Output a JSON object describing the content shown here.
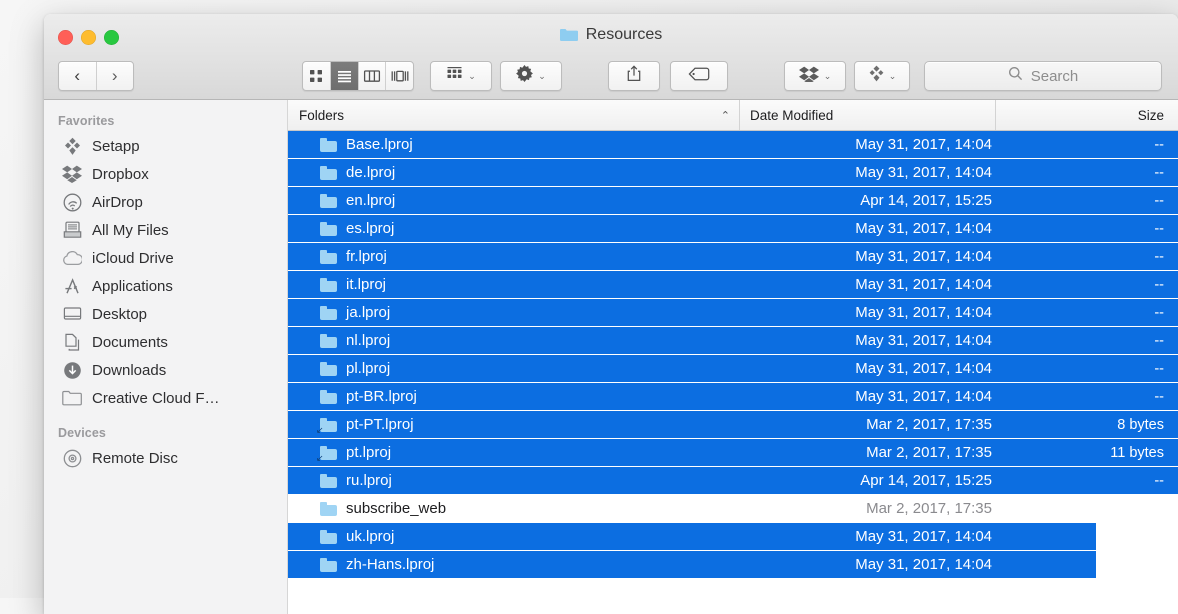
{
  "window": {
    "title": "Resources",
    "title_icon": "folder-icon",
    "traffic_lights": [
      "close-button",
      "minimize-button",
      "zoom-button"
    ]
  },
  "toolbar": {
    "back_label": "‹",
    "forward_label": "›",
    "view_modes": [
      {
        "name": "icon-view",
        "selected": false
      },
      {
        "name": "list-view",
        "selected": true
      },
      {
        "name": "column-view",
        "selected": false
      },
      {
        "name": "gallery-view",
        "selected": false
      }
    ],
    "arrange_label": "arrange-icon",
    "action_label": "gear-icon",
    "share_label": "share-icon",
    "tag_label": "tag-icon",
    "dropbox_label": "dropbox-icon",
    "setapp_label": "setapp-icon",
    "chevron": "⌄",
    "search": {
      "placeholder": "Search",
      "value": "",
      "icon": "search-icon"
    }
  },
  "sidebar": {
    "sections": [
      {
        "header": "Favorites",
        "items": [
          {
            "label": "Setapp",
            "icon": "setapp-icon"
          },
          {
            "label": "Dropbox",
            "icon": "dropbox-icon"
          },
          {
            "label": "AirDrop",
            "icon": "airdrop-icon"
          },
          {
            "label": "All My Files",
            "icon": "all-my-files-icon"
          },
          {
            "label": "iCloud Drive",
            "icon": "icloud-icon"
          },
          {
            "label": "Applications",
            "icon": "applications-icon"
          },
          {
            "label": "Desktop",
            "icon": "desktop-icon"
          },
          {
            "label": "Documents",
            "icon": "documents-icon"
          },
          {
            "label": "Downloads",
            "icon": "downloads-icon"
          },
          {
            "label": "Creative Cloud F…",
            "icon": "folder-icon"
          }
        ]
      },
      {
        "header": "Devices",
        "items": [
          {
            "label": "Remote Disc",
            "icon": "disc-icon"
          }
        ]
      }
    ]
  },
  "file_list": {
    "columns": [
      {
        "label": "Folders",
        "sort": "ascending",
        "sort_caret": "⌃"
      },
      {
        "label": "Date Modified"
      },
      {
        "label": "Size"
      }
    ],
    "rows": [
      {
        "name": "Base.lproj",
        "date": "May 31, 2017, 14:04",
        "size": "--",
        "selected": true,
        "alias": false,
        "clipped": false
      },
      {
        "name": "de.lproj",
        "date": "May 31, 2017, 14:04",
        "size": "--",
        "selected": true,
        "alias": false,
        "clipped": false
      },
      {
        "name": "en.lproj",
        "date": "Apr 14, 2017, 15:25",
        "size": "--",
        "selected": true,
        "alias": false,
        "clipped": false
      },
      {
        "name": "es.lproj",
        "date": "May 31, 2017, 14:04",
        "size": "--",
        "selected": true,
        "alias": false,
        "clipped": false
      },
      {
        "name": "fr.lproj",
        "date": "May 31, 2017, 14:04",
        "size": "--",
        "selected": true,
        "alias": false,
        "clipped": false
      },
      {
        "name": "it.lproj",
        "date": "May 31, 2017, 14:04",
        "size": "--",
        "selected": true,
        "alias": false,
        "clipped": false
      },
      {
        "name": "ja.lproj",
        "date": "May 31, 2017, 14:04",
        "size": "--",
        "selected": true,
        "alias": false,
        "clipped": false
      },
      {
        "name": "nl.lproj",
        "date": "May 31, 2017, 14:04",
        "size": "--",
        "selected": true,
        "alias": false,
        "clipped": false
      },
      {
        "name": "pl.lproj",
        "date": "May 31, 2017, 14:04",
        "size": "--",
        "selected": true,
        "alias": false,
        "clipped": false
      },
      {
        "name": "pt-BR.lproj",
        "date": "May 31, 2017, 14:04",
        "size": "--",
        "selected": true,
        "alias": false,
        "clipped": false
      },
      {
        "name": "pt-PT.lproj",
        "date": "Mar 2, 2017, 17:35",
        "size": "8 bytes",
        "selected": true,
        "alias": true,
        "clipped": false
      },
      {
        "name": "pt.lproj",
        "date": "Mar 2, 2017, 17:35",
        "size": "11 bytes",
        "selected": true,
        "alias": true,
        "clipped": false
      },
      {
        "name": "ru.lproj",
        "date": "Apr 14, 2017, 15:25",
        "size": "--",
        "selected": true,
        "alias": false,
        "clipped": false
      },
      {
        "name": "subscribe_web",
        "date": "Mar 2, 2017, 17:35",
        "size": "",
        "selected": false,
        "alias": false,
        "clipped": false
      },
      {
        "name": "uk.lproj",
        "date": "May 31, 2017, 14:04",
        "size": "",
        "selected": true,
        "alias": false,
        "clipped": true
      },
      {
        "name": "zh-Hans.lproj",
        "date": "May 31, 2017, 14:04",
        "size": "",
        "selected": true,
        "alias": false,
        "clipped": true
      }
    ]
  },
  "colors": {
    "selection_blue": "#0c6ee1",
    "folder_blue": "#9fd4f4",
    "window_chrome": "#e6e6e6"
  }
}
